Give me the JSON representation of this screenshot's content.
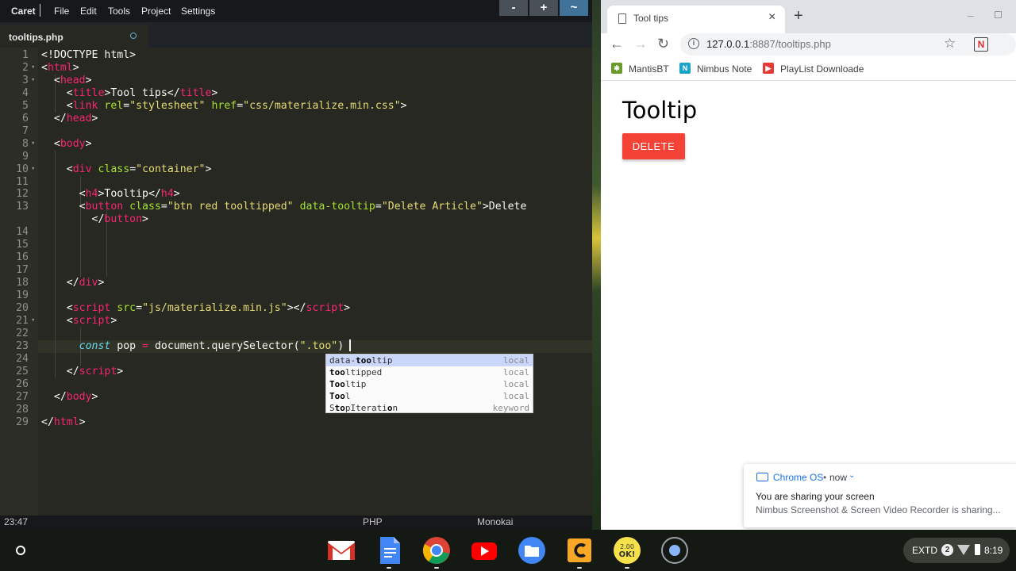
{
  "editor": {
    "app_name": "Caret",
    "menu": [
      "File",
      "Edit",
      "Tools",
      "Project",
      "Settings"
    ],
    "window_buttons": [
      "-",
      "+",
      "~"
    ],
    "active_tab": "tooltips.php",
    "lines": [
      [
        [
          "p",
          "<!DOCTYPE html>"
        ]
      ],
      [
        [
          "p",
          "<"
        ],
        [
          "t",
          "html"
        ],
        [
          "p",
          ">"
        ]
      ],
      [
        [
          "p",
          "  <"
        ],
        [
          "t",
          "head"
        ],
        [
          "p",
          ">"
        ]
      ],
      [
        [
          "p",
          "    <"
        ],
        [
          "t",
          "title"
        ],
        [
          "p",
          ">Tool tips</"
        ],
        [
          "t",
          "title"
        ],
        [
          "p",
          ">"
        ]
      ],
      [
        [
          "p",
          "    <"
        ],
        [
          "t",
          "link"
        ],
        [
          "p",
          " "
        ],
        [
          "a",
          "rel"
        ],
        [
          "p",
          "="
        ],
        [
          "s",
          "\"stylesheet\""
        ],
        [
          "p",
          " "
        ],
        [
          "a",
          "href"
        ],
        [
          "p",
          "="
        ],
        [
          "s",
          "\"css/materialize.min.css\""
        ],
        [
          "p",
          ">"
        ]
      ],
      [
        [
          "p",
          "  </"
        ],
        [
          "t",
          "head"
        ],
        [
          "p",
          ">"
        ]
      ],
      [
        [
          "p",
          ""
        ]
      ],
      [
        [
          "p",
          "  <"
        ],
        [
          "t",
          "body"
        ],
        [
          "p",
          ">"
        ]
      ],
      [
        [
          "p",
          ""
        ]
      ],
      [
        [
          "p",
          "    <"
        ],
        [
          "t",
          "div"
        ],
        [
          "p",
          " "
        ],
        [
          "a",
          "class"
        ],
        [
          "p",
          "="
        ],
        [
          "s",
          "\"container\""
        ],
        [
          "p",
          ">"
        ]
      ],
      [
        [
          "p",
          ""
        ]
      ],
      [
        [
          "p",
          "      <"
        ],
        [
          "t",
          "h4"
        ],
        [
          "p",
          ">Tooltip</"
        ],
        [
          "t",
          "h4"
        ],
        [
          "p",
          ">"
        ]
      ],
      [
        [
          "p",
          "      <"
        ],
        [
          "t",
          "button"
        ],
        [
          "p",
          " "
        ],
        [
          "a",
          "class"
        ],
        [
          "p",
          "="
        ],
        [
          "s",
          "\"btn red tooltipped\""
        ],
        [
          "p",
          " "
        ],
        [
          "a",
          "data-tooltip"
        ],
        [
          "p",
          "="
        ],
        [
          "s",
          "\"Delete Article\""
        ],
        [
          "p",
          ">Delete"
        ]
      ],
      [
        [
          "p",
          "        </"
        ],
        [
          "t",
          "button"
        ],
        [
          "p",
          ">"
        ]
      ],
      [
        [
          "p",
          ""
        ]
      ],
      [
        [
          "p",
          ""
        ]
      ],
      [
        [
          "p",
          ""
        ]
      ],
      [
        [
          "p",
          ""
        ]
      ],
      [
        [
          "p",
          "    </"
        ],
        [
          "t",
          "div"
        ],
        [
          "p",
          ">"
        ]
      ],
      [
        [
          "p",
          ""
        ]
      ],
      [
        [
          "p",
          "    <"
        ],
        [
          "t",
          "script"
        ],
        [
          "p",
          " "
        ],
        [
          "a",
          "src"
        ],
        [
          "p",
          "="
        ],
        [
          "s",
          "\"js/materialize.min.js\""
        ],
        [
          "p",
          "></"
        ],
        [
          "t",
          "script"
        ],
        [
          "p",
          ">"
        ]
      ],
      [
        [
          "p",
          "    <"
        ],
        [
          "t",
          "script"
        ],
        [
          "p",
          ">"
        ]
      ],
      [
        [
          "p",
          ""
        ]
      ],
      [
        [
          "p",
          "      "
        ],
        [
          "k",
          "const"
        ],
        [
          "p",
          " pop "
        ],
        [
          "t",
          "="
        ],
        [
          "p",
          " document.querySelector("
        ],
        [
          "s",
          "\".too\""
        ],
        [
          "p",
          ")"
        ]
      ],
      [
        [
          "p",
          ""
        ]
      ],
      [
        [
          "p",
          "    </"
        ],
        [
          "t",
          "script"
        ],
        [
          "p",
          ">"
        ]
      ],
      [
        [
          "p",
          ""
        ]
      ],
      [
        [
          "p",
          "  </"
        ],
        [
          "t",
          "body"
        ],
        [
          "p",
          ">"
        ]
      ],
      [
        [
          "p",
          ""
        ]
      ],
      [
        [
          "p",
          "</"
        ],
        [
          "t",
          "html"
        ],
        [
          "p",
          ">"
        ]
      ]
    ],
    "line_numbers": [
      "1",
      "2",
      "3",
      "4",
      "5",
      "6",
      "7",
      "8",
      "9",
      "10",
      "11",
      "12",
      "13",
      "",
      "14",
      "15",
      "16",
      "17",
      "18",
      "19",
      "20",
      "21",
      "22",
      "23",
      "24",
      "25",
      "26",
      "27",
      "28",
      "29"
    ],
    "autocomplete": [
      {
        "pre": "data-",
        "bold": "too",
        "post": "ltip",
        "kind": "local"
      },
      {
        "pre": "",
        "bold": "too",
        "post": "ltipped",
        "kind": "local"
      },
      {
        "pre": "",
        "bold": "Too",
        "post": "ltip",
        "kind": "local"
      },
      {
        "pre": "",
        "bold": "Too",
        "post": "l",
        "kind": "local"
      },
      {
        "pre": "S",
        "bold": "to",
        "post": "pIterati",
        "bold2": "o",
        "post2": "n",
        "kind": "keyword"
      }
    ],
    "status": {
      "position": "23:47",
      "mode": "PHP",
      "theme": "Monokai"
    }
  },
  "browser": {
    "tab_title": "Tool tips",
    "url_host": "127.0.0.1",
    "url_rest": ":8887/tooltips.php",
    "bookmarks": [
      {
        "label": "MantisBT",
        "color": "#6a9a2a",
        "icon": "bug-icon"
      },
      {
        "label": "Nimbus Note",
        "color": "#1aa3c9",
        "icon": "N"
      },
      {
        "label": "PlayList Downloade",
        "color": "#e53935",
        "icon": "play-icon"
      }
    ],
    "page": {
      "heading": "Tooltip",
      "button": "DELETE"
    }
  },
  "notification": {
    "app": "Chrome OS",
    "time": "now",
    "title": "You are sharing your screen",
    "body": "Nimbus Screenshot & Screen Video Recorder is sharing..."
  },
  "shelf": {
    "apps": [
      "gmail-icon",
      "docs-icon",
      "chrome-icon",
      "youtube-icon",
      "files-icon",
      "caret-icon",
      "2doo-icon",
      "record-icon"
    ],
    "tray": {
      "extd": "EXTD",
      "badge": "2",
      "time": "8:19"
    }
  },
  "colors": {
    "editor_bg": "#272822",
    "delete_button": "#f44336",
    "accent": "#1a73e8"
  }
}
